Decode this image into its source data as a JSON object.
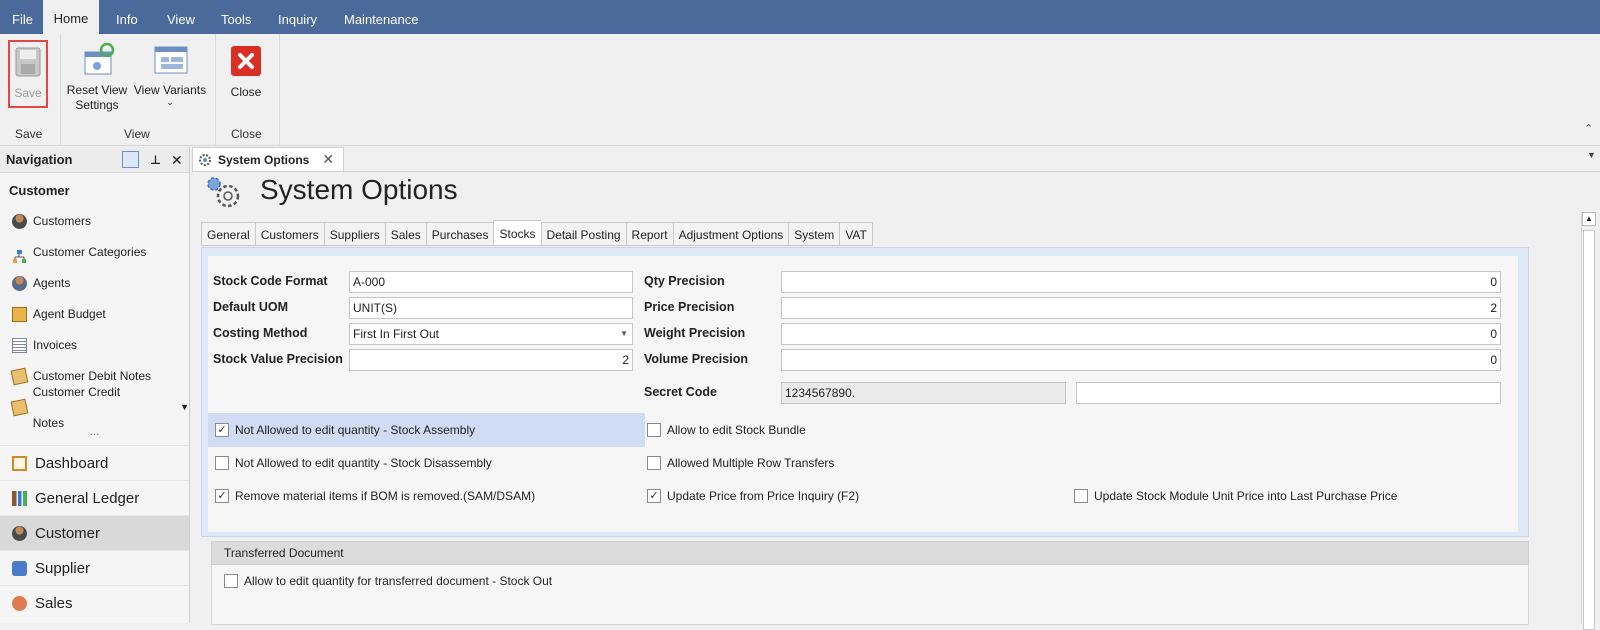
{
  "menu": [
    "File",
    "Home",
    "Info",
    "View",
    "Tools",
    "Inquiry",
    "Maintenance"
  ],
  "ribbon": {
    "save_label": "Save",
    "reset_label_1": "Reset View",
    "reset_label_2": "Settings",
    "variants_label": "View Variants",
    "close_label": "Close",
    "group_save": "Save",
    "group_view": "View",
    "group_close": "Close"
  },
  "nav": {
    "title": "Navigation",
    "section": "Customer",
    "items": [
      "Customers",
      "Customer Categories",
      "Agents",
      "Agent Budget",
      "Invoices",
      "Customer Debit Notes",
      "Customer Credit Notes"
    ],
    "modules": [
      "Dashboard",
      "General Ledger",
      "Customer",
      "Supplier",
      "Sales"
    ],
    "more": "..."
  },
  "doc_tab": {
    "label": "System Options"
  },
  "page_title": "System Options",
  "tabs": [
    "General",
    "Customers",
    "Suppliers",
    "Sales",
    "Purchases",
    "Stocks",
    "Detail Posting",
    "Report",
    "Adjustment Options",
    "System",
    "VAT"
  ],
  "selected_tab": "Stocks",
  "form": {
    "stock_code_format_label": "Stock Code Format",
    "stock_code_format": "A-000",
    "default_uom_label": "Default UOM",
    "default_uom": "UNIT(S)",
    "costing_method_label": "Costing Method",
    "costing_method": "First In First Out",
    "stock_value_precision_label": "Stock Value Precision",
    "stock_value_precision": "2",
    "qty_precision_label": "Qty Precision",
    "qty_precision": "0",
    "price_precision_label": "Price Precision",
    "price_precision": "2",
    "weight_precision_label": "Weight Precision",
    "weight_precision": "0",
    "volume_precision_label": "Volume Precision",
    "volume_precision": "0",
    "secret_code_label": "Secret Code",
    "secret_code": "1234567890.",
    "secret_code_2": ""
  },
  "checks": {
    "not_allowed_assembly": {
      "label": "Not Allowed to edit quantity - Stock Assembly",
      "checked": true
    },
    "allow_bundle": {
      "label": "Allow to edit Stock Bundle",
      "checked": false
    },
    "not_allowed_disassembly": {
      "label": "Not Allowed to edit quantity - Stock Disassembly",
      "checked": false
    },
    "multiple_row": {
      "label": "Allowed Multiple Row Transfers",
      "checked": false
    },
    "remove_material": {
      "label": "Remove material items if BOM is removed.(SAM/DSAM)",
      "checked": true
    },
    "update_price": {
      "label": "Update Price from Price Inquiry (F2)",
      "checked": true
    },
    "update_unit_price": {
      "label": "Update Stock Module Unit Price into Last Purchase Price",
      "checked": false
    },
    "transferred_edit": {
      "label": "Allow to edit quantity for transferred document - Stock Out",
      "checked": false
    }
  },
  "transferred_section": "Transferred Document",
  "check_glyph": "✓"
}
